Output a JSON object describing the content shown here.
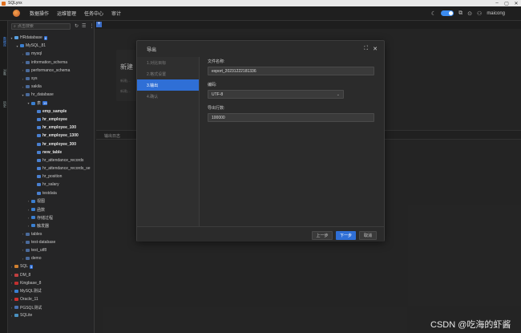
{
  "window": {
    "title": "SQLynx"
  },
  "menu": {
    "items": [
      "数据操作",
      "运维管理",
      "任务中心",
      "审计"
    ]
  },
  "header": {
    "username": "maicong"
  },
  "activity": {
    "items": [
      "数据库",
      "对象",
      "历史"
    ]
  },
  "sidebar": {
    "search_placeholder": "点击搜索",
    "tree": [
      {
        "label": "HRdatabase",
        "badge": "8",
        "indent": 0,
        "arrow": "▾",
        "icon": "#5aa0e0"
      },
      {
        "label": "MySQL_81",
        "indent": 1,
        "arrow": "▾",
        "icon": "#3a7fd0"
      },
      {
        "label": "mysql",
        "indent": 2,
        "arrow": "›",
        "icon": "#4a6a9a"
      },
      {
        "label": "information_schema",
        "indent": 2,
        "arrow": "›",
        "icon": "#4a6a9a"
      },
      {
        "label": "performance_schema",
        "indent": 2,
        "arrow": "›",
        "icon": "#4a6a9a"
      },
      {
        "label": "sys",
        "indent": 2,
        "arrow": "›",
        "icon": "#4a6a9a"
      },
      {
        "label": "sakila",
        "indent": 2,
        "arrow": "›",
        "icon": "#4a6a9a"
      },
      {
        "label": "hr_database",
        "indent": 2,
        "arrow": "▾",
        "icon": "#4a6a9a"
      },
      {
        "label": "表",
        "badge": "19",
        "indent": 3,
        "arrow": "▾",
        "icon": "#3a7fd0"
      },
      {
        "label": "emp_sample",
        "indent": 4,
        "bold": true,
        "icon": "#4a80d0"
      },
      {
        "label": "hr_employee",
        "indent": 4,
        "bold": true,
        "icon": "#4a80d0"
      },
      {
        "label": "hr_employee_100",
        "indent": 4,
        "bold": true,
        "icon": "#4a80d0"
      },
      {
        "label": "hr_employee_1300",
        "indent": 4,
        "bold": true,
        "icon": "#4a80d0"
      },
      {
        "label": "hr_employee_300",
        "indent": 4,
        "bold": true,
        "icon": "#4a80d0"
      },
      {
        "label": "new_table",
        "indent": 4,
        "bold": true,
        "icon": "#4a80d0"
      },
      {
        "label": "hr_attendance_records",
        "indent": 4,
        "icon": "#4a80d0"
      },
      {
        "label": "hr_attendance_records_se",
        "indent": 4,
        "icon": "#4a80d0"
      },
      {
        "label": "hr_position",
        "indent": 4,
        "icon": "#4a80d0"
      },
      {
        "label": "hr_salary",
        "indent": 4,
        "icon": "#4a80d0"
      },
      {
        "label": "testdata",
        "indent": 4,
        "icon": "#4a80d0"
      },
      {
        "label": "视图",
        "indent": 3,
        "arrow": "›",
        "icon": "#3a7fd0"
      },
      {
        "label": "函数",
        "indent": 3,
        "arrow": "›",
        "icon": "#3a7fd0"
      },
      {
        "label": "存储过程",
        "indent": 3,
        "arrow": "›",
        "icon": "#3a7fd0"
      },
      {
        "label": "触发器",
        "indent": 3,
        "arrow": "›",
        "icon": "#3a7fd0"
      },
      {
        "label": "tables",
        "indent": 2,
        "arrow": "›",
        "icon": "#4a6a9a"
      },
      {
        "label": "test-database",
        "indent": 2,
        "arrow": "›",
        "icon": "#4a6a9a"
      },
      {
        "label": "test_utf8",
        "indent": 2,
        "arrow": "›",
        "icon": "#4a6a9a"
      },
      {
        "label": "demo",
        "indent": 2,
        "arrow": "›",
        "icon": "#4a6a9a"
      },
      {
        "label": "SQL",
        "badge": "3",
        "indent": 0,
        "arrow": "›",
        "icon": "#d08030"
      },
      {
        "label": "DM_8",
        "indent": 0,
        "arrow": "›",
        "icon": "#c04040"
      },
      {
        "label": "Kingbase_8",
        "indent": 0,
        "arrow": "›",
        "icon": "#c03030"
      },
      {
        "label": "MySQL测试",
        "indent": 0,
        "arrow": "›",
        "icon": "#3a7fd0"
      },
      {
        "label": "Oracle_11",
        "indent": 0,
        "arrow": "›",
        "icon": "#d03030"
      },
      {
        "label": "PGSQL测试",
        "indent": 0,
        "arrow": "›",
        "icon": "#4a70b0"
      },
      {
        "label": "SQLite",
        "indent": 0,
        "arrow": "›",
        "icon": "#4a90c0"
      }
    ]
  },
  "background": {
    "card_title": "新建",
    "card_line1": "新建(...",
    "card_line2": "新建(...",
    "output_tab": "输出日志"
  },
  "modal": {
    "title": "导出",
    "steps": [
      "1.对比目标",
      "2.格式设置",
      "3.输出",
      "4.确认"
    ],
    "active_step": 2,
    "fields": {
      "filename_label": "文件名称:",
      "filename_value": "export_20231222181336",
      "encoding_label": "编码:",
      "encoding_value": "UTF-8",
      "rows_label": "导出行数:",
      "rows_value": "100000"
    },
    "buttons": {
      "prev": "上一步",
      "next": "下一步",
      "cancel": "取消"
    }
  },
  "watermark": "CSDN @吃海的虾酱"
}
